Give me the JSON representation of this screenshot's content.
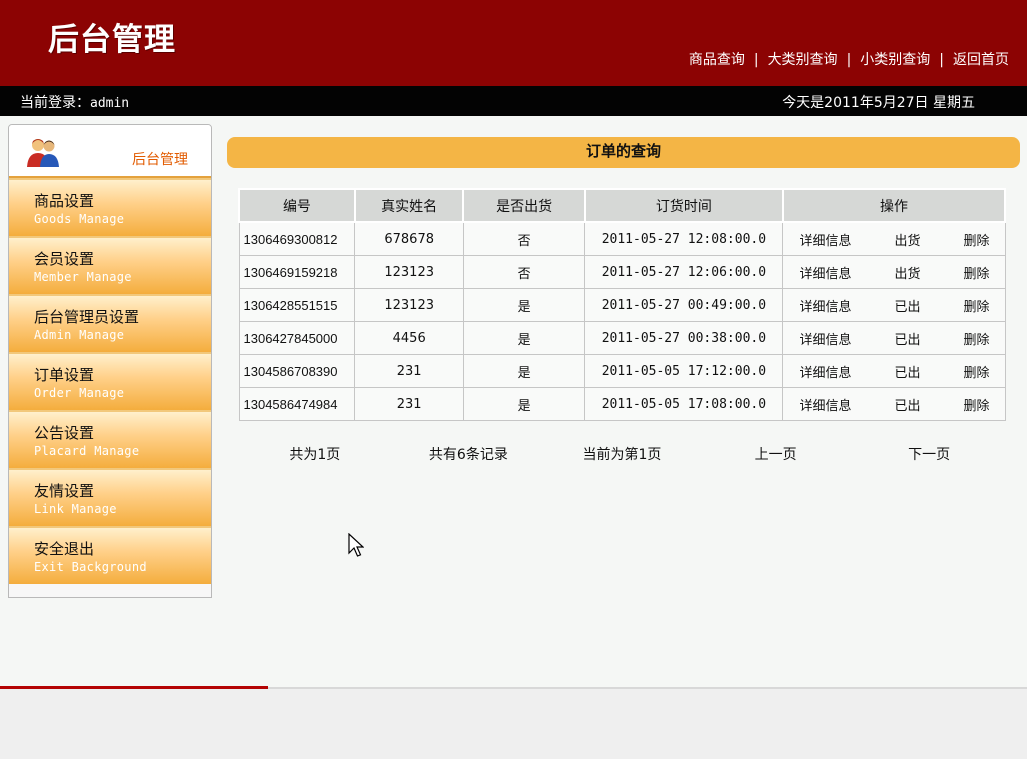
{
  "header": {
    "logo": "后台管理",
    "nav": [
      "商品查询",
      "大类别查询",
      "小类别查询",
      "返回首页"
    ],
    "nav_separator": "|"
  },
  "status_bar": {
    "login_prefix": "当前登录：",
    "login_user": "admin",
    "date_text": "今天是2011年5月27日 星期五"
  },
  "sidebar": {
    "title": "后台管理",
    "items": [
      {
        "label": "商品设置",
        "sub": "Goods Manage"
      },
      {
        "label": "会员设置",
        "sub": "Member Manage"
      },
      {
        "label": "后台管理员设置",
        "sub": "Admin Manage"
      },
      {
        "label": "订单设置",
        "sub": "Order Manage"
      },
      {
        "label": "公告设置",
        "sub": "Placard Manage"
      },
      {
        "label": "友情设置",
        "sub": "Link Manage"
      },
      {
        "label": "安全退出",
        "sub": "Exit Background"
      }
    ]
  },
  "main": {
    "title": "订单的查询",
    "table": {
      "headers": [
        "编号",
        "真实姓名",
        "是否出货",
        "订货时间",
        "操作"
      ],
      "rows": [
        {
          "id": "1306469300812",
          "name": "678678",
          "shipped": "否",
          "time": "2011-05-27 12:08:00.0",
          "actions": [
            "详细信息",
            "出货",
            "删除"
          ]
        },
        {
          "id": "1306469159218",
          "name": "123123",
          "shipped": "否",
          "time": "2011-05-27 12:06:00.0",
          "actions": [
            "详细信息",
            "出货",
            "删除"
          ]
        },
        {
          "id": "1306428551515",
          "name": "123123",
          "shipped": "是",
          "time": "2011-05-27 00:49:00.0",
          "actions": [
            "详细信息",
            "已出",
            "删除"
          ]
        },
        {
          "id": "1306427845000",
          "name": "4456",
          "shipped": "是",
          "time": "2011-05-27 00:38:00.0",
          "actions": [
            "详细信息",
            "已出",
            "删除"
          ]
        },
        {
          "id": "1304586708390",
          "name": "231",
          "shipped": "是",
          "time": "2011-05-05 17:12:00.0",
          "actions": [
            "详细信息",
            "已出",
            "删除"
          ]
        },
        {
          "id": "1304586474984",
          "name": "231",
          "shipped": "是",
          "time": "2011-05-05 17:08:00.0",
          "actions": [
            "详细信息",
            "已出",
            "删除"
          ]
        }
      ]
    },
    "pagination": {
      "total_pages": "共为1页",
      "total_records": "共有6条记录",
      "current_page": "当前为第1页",
      "prev": "上一页",
      "next": "下一页"
    }
  },
  "colors": {
    "header_bg": "#8c0303",
    "accent_orange": "#f4b545",
    "sidebar_title": "#e25b00"
  },
  "icons": {
    "sidebar_header": "admin-users-icon",
    "cursor": "mouse-pointer-icon"
  }
}
